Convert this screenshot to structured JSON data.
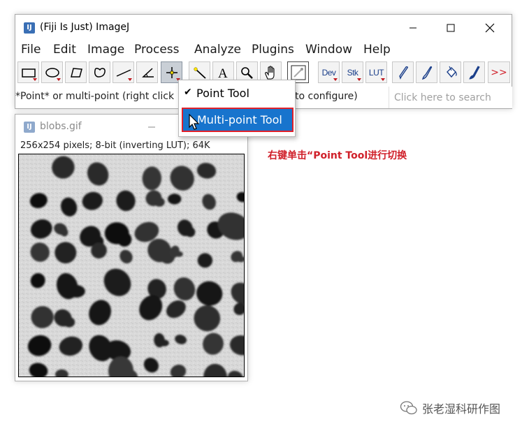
{
  "main_window": {
    "title": "(Fiji Is Just) ImageJ",
    "app_icon_glyph": "fiji",
    "controls": [
      "minimize",
      "maximize",
      "close"
    ]
  },
  "menubar": {
    "items": [
      "File",
      "Edit",
      "Image",
      "Process",
      "Analyze",
      "Plugins",
      "Window",
      "Help"
    ]
  },
  "toolbar": {
    "tools": [
      {
        "name": "rectangle-tool",
        "icon": "rectangle-icon",
        "has_menu": true
      },
      {
        "name": "oval-tool",
        "icon": "oval-icon",
        "has_menu": true
      },
      {
        "name": "polygon-tool",
        "icon": "polygon-icon",
        "has_menu": false
      },
      {
        "name": "freehand-tool",
        "icon": "freehand-icon",
        "has_menu": false
      },
      {
        "name": "line-tool",
        "icon": "line-icon",
        "has_menu": true
      },
      {
        "name": "angle-tool",
        "icon": "angle-icon",
        "has_menu": false
      },
      {
        "name": "point-tool",
        "icon": "crosshair-icon",
        "has_menu": true,
        "selected": true
      },
      {
        "name": "wand-tool",
        "icon": "wand-icon",
        "has_menu": false
      },
      {
        "name": "text-tool",
        "icon": "text-icon",
        "has_menu": false
      },
      {
        "name": "magnifier-tool",
        "icon": "magnifier-icon",
        "has_menu": false
      },
      {
        "name": "scroll-tool",
        "icon": "hand-icon",
        "has_menu": false
      },
      {
        "name": "color-picker-tool",
        "icon": "dropper-icon",
        "has_menu": false
      },
      {
        "name": "dev-tool",
        "label": "Dev",
        "has_menu": true
      },
      {
        "name": "stk-tool",
        "label": "Stk",
        "has_menu": true
      },
      {
        "name": "lut-tool",
        "label": "LUT",
        "has_menu": true
      },
      {
        "name": "pencil-tool",
        "icon": "pencil-icon",
        "has_menu": false
      },
      {
        "name": "brush-tool",
        "icon": "brush-icon",
        "has_menu": false
      },
      {
        "name": "flood-fill-tool",
        "icon": "bucket-icon",
        "has_menu": false
      },
      {
        "name": "paintbrush-tool",
        "icon": "paintbrush-icon",
        "has_menu": false
      },
      {
        "name": "more-tools",
        "label": ">>",
        "has_menu": false
      }
    ],
    "dev_label": "Dev",
    "stk_label": "Stk",
    "lut_label": "LUT",
    "more_label": ">>"
  },
  "status": {
    "text_left": "*Point* or multi-point (right click",
    "text_right": "to configure)",
    "search_placeholder": "Click here to search"
  },
  "image_window": {
    "title": "blobs.gif",
    "info": "256x254 pixels; 8-bit (inverting LUT); 64K"
  },
  "popup_menu": {
    "items": [
      {
        "label": "Point Tool",
        "checked": true
      },
      {
        "label": "Multi-point Tool",
        "highlighted": true
      }
    ]
  },
  "annotation": {
    "text": "右键单击“Point Tool进行切换",
    "color": "#d0202a"
  },
  "watermark": {
    "text": "张老湿科研作图"
  },
  "colors": {
    "selection_blue": "#1874cd",
    "highlight_red": "#e0202a",
    "link_blue": "#1b3f8a"
  }
}
